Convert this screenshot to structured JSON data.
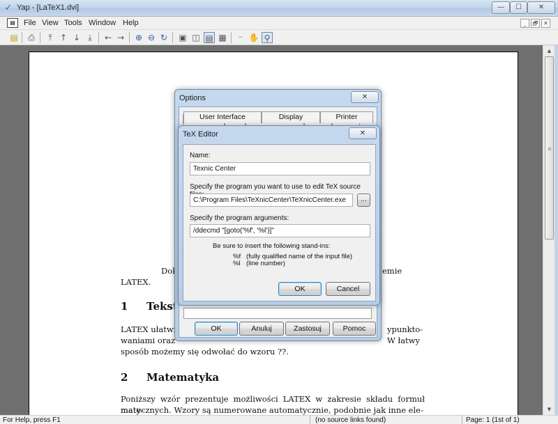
{
  "window": {
    "title": "Yap - [LaTeX1.dvi]",
    "controls": {
      "minimize": "—",
      "maximize": "☐",
      "close": "✕"
    }
  },
  "menu": {
    "items": [
      "File",
      "View",
      "Tools",
      "Window",
      "Help"
    ],
    "mdi": {
      "minimize": "_",
      "restore": "🗗",
      "close": "✕"
    }
  },
  "toolbar": {
    "icons": [
      "open-icon",
      "print-icon",
      "first-page-icon",
      "previous-page-icon",
      "next-page-icon",
      "last-page-icon",
      "back-icon",
      "forward-icon",
      "zoom-in-icon",
      "zoom-out-icon",
      "refresh-icon",
      "single-page-icon",
      "double-page-icon",
      "continuous-icon",
      "continuous-double-icon",
      "ruler-icon",
      "hand-tool-icon",
      "magnifier-icon"
    ]
  },
  "document": {
    "line_dok": "Dok",
    "line_dok_right": "emie",
    "latex_word": "LATEX.",
    "section1_number": "1",
    "section1_title": "Tekst",
    "para1_line1_left": "LATEX ułatwi",
    "para1_line1_right": "ypunkto-",
    "para1_line2_left": "waniami oraz",
    "para1_line2_right": "W łatwy",
    "para1_line3": "sposób możemy się odwołać do wzoru ??.",
    "section2_number": "2",
    "section2_title": "Matematyka",
    "para2_line1": "Poniższy wzór prezentuje możliwości LATEX w zakresie składu formuł mate-",
    "para2_line2": "matycznych. Wzory są numerowane automatycznie, podobnie jak inne ele-"
  },
  "statusbar": {
    "help": "For Help, press F1",
    "source": "(no source links found)",
    "page": "Page: 1 (1st of 1)"
  },
  "options_dialog": {
    "title": "Options",
    "close": "✕",
    "tabs_back": [
      "",
      "",
      "",
      "",
      ""
    ],
    "tabs_front": [
      "User Interface",
      "Display",
      "Printer"
    ],
    "buttons": {
      "ok": "OK",
      "cancel": "Anuluj",
      "apply": "Zastosuj",
      "help": "Pomoc"
    }
  },
  "tex_editor_dialog": {
    "title": "TeX Editor",
    "close": "✕",
    "name_label": "Name:",
    "name_value": "Texnic Center",
    "program_label": "Specify the program you want to use to edit TeX source files:",
    "program_value": "C:\\Program Files\\TeXnicCenter\\TeXnicCenter.exe",
    "browse": "...",
    "args_label": "Specify the program arguments:",
    "args_value": "/ddecmd \"[goto('%f', '%l')]\"",
    "standins_title": "Be sure to insert the following stand-ins:",
    "standin1_key": "%f",
    "standin1_desc": "(fully qualified name of the input file)",
    "standin2_key": "%l",
    "standin2_desc": "(line number)",
    "ok": "OK",
    "cancel": "Cancel"
  }
}
